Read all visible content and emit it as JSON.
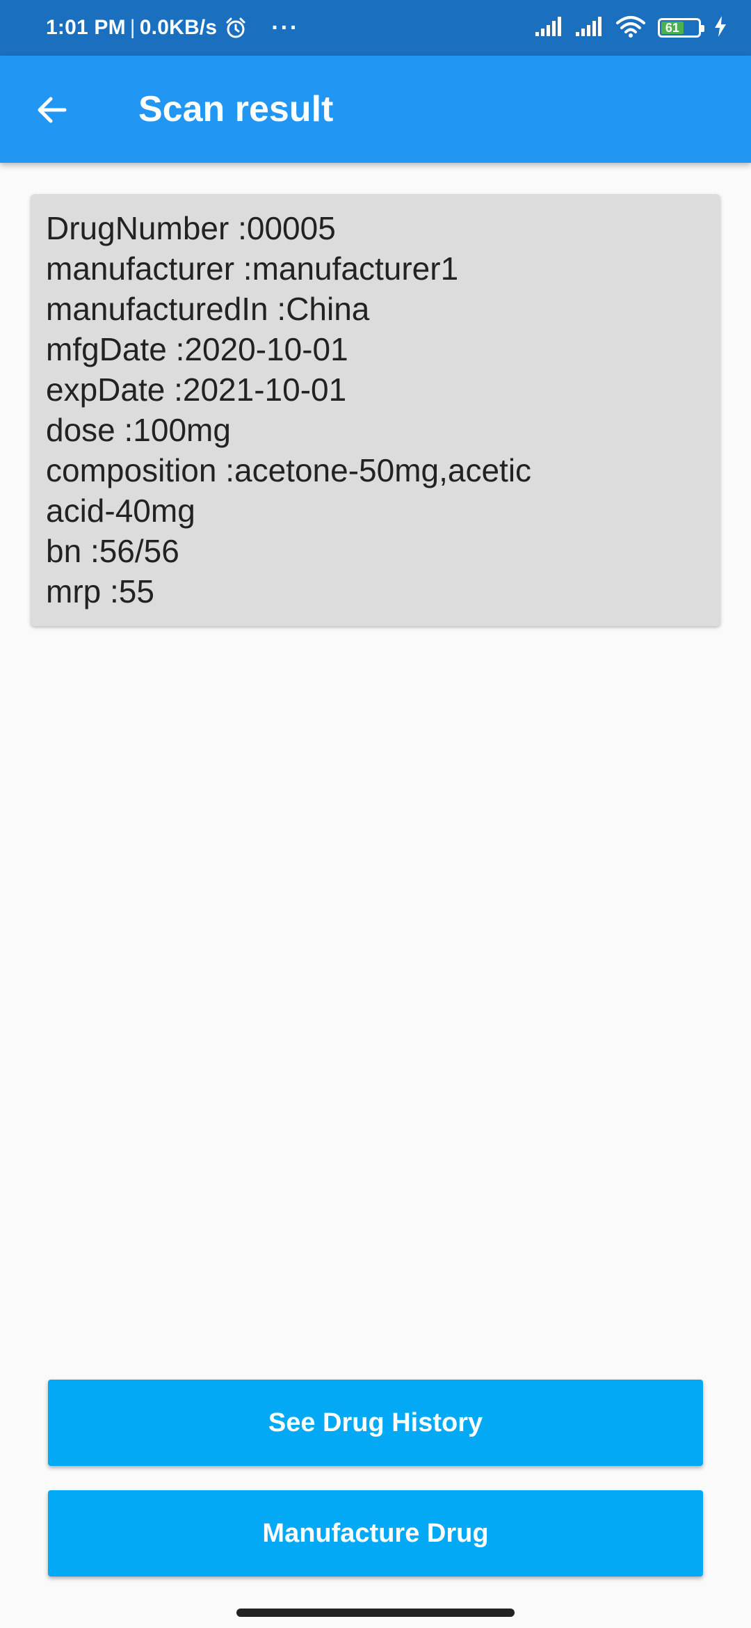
{
  "status_bar": {
    "time": "1:01 PM",
    "separator": "|",
    "net_speed": "0.0KB/s",
    "more": "···",
    "battery_level": "61",
    "battery_fill_fraction": 0.61,
    "icons": [
      "alarm-icon",
      "signal-icon",
      "signal-icon",
      "wifi-icon",
      "battery-icon",
      "charging-icon"
    ],
    "bg_color": "#1a6fbf"
  },
  "app_bar": {
    "title": "Scan result",
    "back_icon": "arrow-left-icon",
    "bg_color": "#2196f3"
  },
  "result": {
    "lines": [
      "DrugNumber :00005",
      "manufacturer :manufacturer1",
      "manufacturedIn :China",
      "mfgDate :2020-10-01",
      "expDate :2021-10-01",
      "dose :100mg",
      "composition :acetone-50mg,acetic",
      "acid-40mg",
      "bn :56/56",
      "mrp :55"
    ],
    "card_color": "#dcdcdc"
  },
  "buttons": {
    "see_history": "See Drug History",
    "manufacture": "Manufacture Drug",
    "color": "#03a9f4"
  }
}
